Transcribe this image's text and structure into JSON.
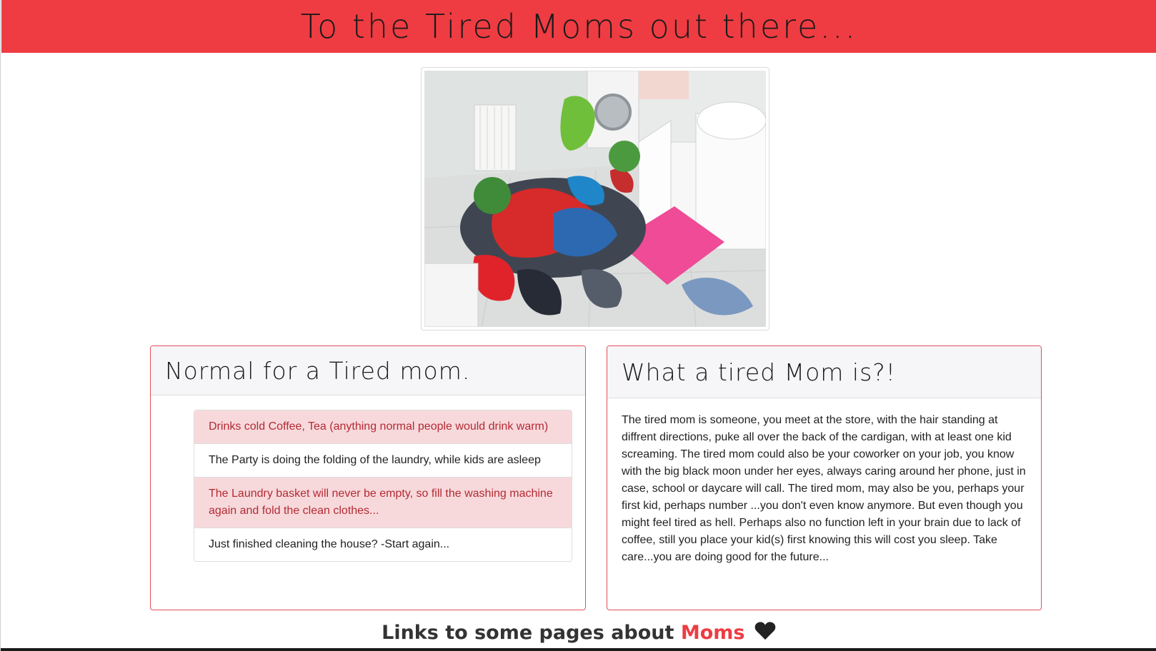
{
  "header": {
    "title": "To the Tired Moms out there..."
  },
  "hero": {
    "image_alt": "Messy bathroom with laundry piled on the floor"
  },
  "left_card": {
    "title": "Normal for a Tired mom.",
    "items": [
      {
        "text": "Drinks cold Coffee, Tea (anything normal people would drink warm)",
        "style": "danger"
      },
      {
        "text": "The Party is doing the folding of the laundry, while kids are asleep",
        "style": "plain"
      },
      {
        "text": "The Laundry basket will never be empty, so fill the washing machine again and fold the clean clothes...",
        "style": "danger"
      },
      {
        "text": "Just finished cleaning the house? -Start again...",
        "style": "plain"
      }
    ]
  },
  "right_card": {
    "title": "What a tired Mom is?!",
    "body": "The tired mom is someone, you meet at the store, with the hair standing at diffrent directions, puke all over the back of the cardigan, with at least one kid screaming. The tired mom could also be your coworker on your job, you know with the big black moon under her eyes, always caring around her phone, just in case, school or daycare will call. The tired mom, may also be you, perhaps your first kid, perhaps number ...you don't even know anymore. But even though you might feel tired as hell. Perhaps also no function left in your brain due to lack of coffee, still you place your kid(s) first knowing this will cost you sleep. Take care...you are doing good for the future..."
  },
  "links": {
    "prefix": "Links to some pages about",
    "accent": "Moms",
    "icon": "heart-icon"
  },
  "colors": {
    "brand_red": "#ee3c42",
    "danger_bg": "#f7d9dc",
    "danger_text": "#b42a33"
  }
}
